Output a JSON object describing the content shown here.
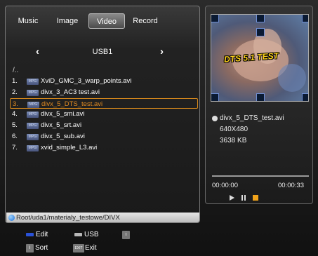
{
  "tabs": [
    {
      "label": "Music",
      "active": false
    },
    {
      "label": "Image",
      "active": false
    },
    {
      "label": "Video",
      "active": true
    },
    {
      "label": "Record",
      "active": false
    }
  ],
  "nav": {
    "prev_glyph": "‹",
    "next_glyph": "›",
    "title": "USB1"
  },
  "parent_dir": "/..",
  "files": [
    {
      "num": "1.",
      "icon": "mpg-file-icon",
      "name": "XviD_GMC_3_warp_points.avi",
      "selected": false
    },
    {
      "num": "2.",
      "icon": "mpg-file-icon",
      "name": "divx_3_AC3 test.avi",
      "selected": false
    },
    {
      "num": "3.",
      "icon": "mpg-file-icon",
      "name": "divx_5_DTS_test.avi",
      "selected": true
    },
    {
      "num": "4.",
      "icon": "mpg-file-icon",
      "name": "divx_5_smi.avi",
      "selected": false
    },
    {
      "num": "5.",
      "icon": "mpg-file-icon",
      "name": "divx_5_srt.avi",
      "selected": false
    },
    {
      "num": "6.",
      "icon": "mpg-file-icon",
      "name": "divx_5_sub.avi",
      "selected": false
    },
    {
      "num": "7.",
      "icon": "mpg-file-icon",
      "name": "xvid_simple_L3.avi",
      "selected": false
    }
  ],
  "file_icon_text": "MPG",
  "path": "Root/uda1/materialy_testowe/DIVX",
  "preview": {
    "overlay_text": "DTS 5.1 TEST"
  },
  "info": {
    "filename": "divx_5_DTS_test.avi",
    "resolution": "640X480",
    "size": "3638 KB"
  },
  "playback": {
    "elapsed": "00:00:00",
    "total": "00:00:33",
    "progress": 0.0
  },
  "colors": {
    "selection": "#e08a22",
    "edit_key": "#2a52d8",
    "usb_key": "#b8b8b8",
    "stop_button": "#f0a21a"
  },
  "keys": [
    {
      "type": "swatch",
      "color": "edit_key",
      "label": "Edit"
    },
    {
      "type": "swatch",
      "color": "usb_key",
      "label": "USB"
    },
    {
      "type": "box",
      "icon": "info-icon",
      "box_text": "i",
      "label": ""
    },
    {
      "type": "box",
      "icon": "info-icon",
      "box_text": "i",
      "label": "Sort"
    },
    {
      "type": "box",
      "icon": "exit-icon",
      "box_text": "EXIT",
      "label": "Exit"
    }
  ]
}
